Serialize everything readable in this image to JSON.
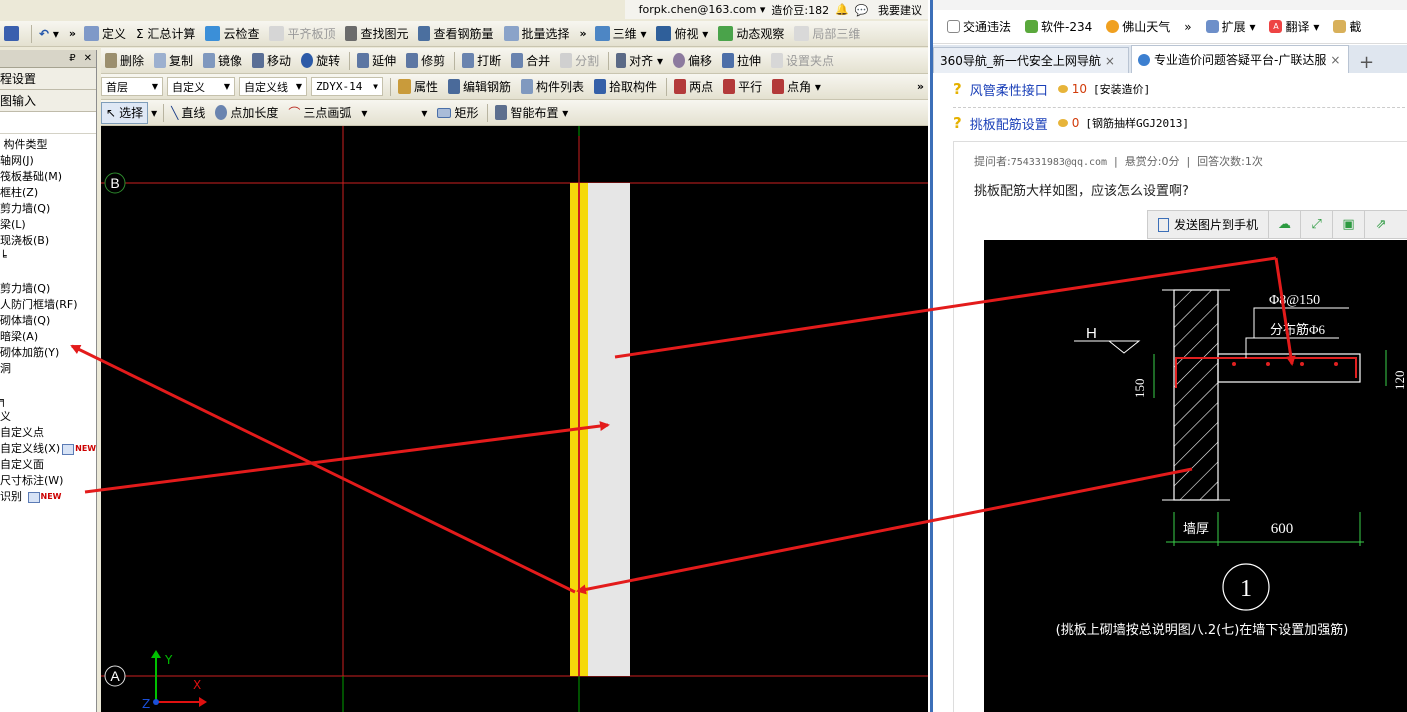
{
  "app": {
    "topbar": {
      "user": "forpk.chen@163.com ▾",
      "beans": "造价豆:182",
      "feedback": "我要建议"
    },
    "toolbar1": {
      "items": [
        "定义",
        "Σ 汇总计算",
        "云检查",
        "平齐板顶",
        "查找图元",
        "查看钢筋量",
        "批量选择",
        "三维 ▾",
        "俯视 ▾",
        "动态观察",
        "局部三维"
      ]
    },
    "toolbar2": {
      "items": [
        "删除",
        "复制",
        "镜像",
        "移动",
        "旋转",
        "延伸",
        "修剪",
        "打断",
        "合并",
        "分割",
        "对齐 ▾",
        "偏移",
        "拉伸",
        "设置夹点"
      ]
    },
    "toolbar3": {
      "floor": "首层",
      "type": "自定义",
      "subtype": "自定义线",
      "component": "ZDYX-14",
      "items": [
        "属性",
        "编辑钢筋",
        "构件列表",
        "拾取构件",
        "两点",
        "平行",
        "点角 ▾"
      ]
    },
    "toolbar4": {
      "select": "选择",
      "items": [
        "直线",
        "点加长度",
        "三点画弧"
      ],
      "rect": "矩形",
      "smart": "智能布置 ▾"
    },
    "leftpanel": {
      "header_pin": "₽",
      "header_close": "✕",
      "tab1": "程设置",
      "tab2": "图输入",
      "tree": [
        "构件类型",
        "轴网(J)",
        "筏板基础(M)",
        "框柱(Z)",
        "剪力墙(Q)",
        "梁(L)",
        "现浇板(B)",
        "",
        "",
        "剪力墙(Q)",
        "人防门框墙(RF)",
        "砌体墙(Q)",
        "暗梁(A)",
        "砌体加筋(Y)",
        "洞",
        "",
        "",
        "义",
        "自定义点",
        "自定义线(X)",
        "自定义面",
        "尺寸标注(W)",
        "识别"
      ],
      "new_badge": "NEW"
    },
    "canvas": {
      "axis_b": "B",
      "axis_a": "A",
      "ucs_y": "Y",
      "ucs_x": "X",
      "ucs_z": "Z"
    }
  },
  "browser": {
    "bookmarks": [
      "交通违法",
      "软件-234",
      "佛山天气",
      "»",
      "扩展",
      "翻译",
      "截"
    ],
    "tabs": [
      {
        "label": "360导航_新一代安全上网导航",
        "close": "×"
      },
      {
        "label": "专业造价问题答疑平台-广联达服",
        "close": "×"
      }
    ],
    "new_tab": "+",
    "questions": [
      {
        "title": "风管柔性接口",
        "points": "10",
        "tag": "[安装造价]"
      },
      {
        "title": "挑板配筋设置",
        "points": "0",
        "tag": "[钢筋抽样GGJ2013]"
      }
    ],
    "meta": {
      "asker_label": "提问者:",
      "asker": "754331983@qq.com",
      "reward": "悬赏分:0分",
      "answers": "回答次数:1次"
    },
    "question_text": "挑板配筋大样如图，应该怎么设置啊?",
    "image_toolbar": {
      "send": "发送图片到手机"
    },
    "drawing": {
      "rebar_top": "Φ8@150",
      "rebar_dist": "分布筋Φ6",
      "level": "H",
      "dim_150": "150",
      "dim_120": "120",
      "wall_thickness": "墙厚",
      "dim_600": "600",
      "detail_no": "1",
      "note": "(挑板上砌墙按总说明图八.2(七)在墙下设置加强筋)"
    }
  },
  "colors": {
    "canvas_bg": "#000000",
    "grid_line": "#cc1f1f",
    "wall_yellow": "#f5d90a",
    "wall_gray": "#e6e6e6",
    "arrow_red": "#e31b1b",
    "link_blue": "#1a3fb8",
    "tab_border": "#3c6fb8"
  }
}
